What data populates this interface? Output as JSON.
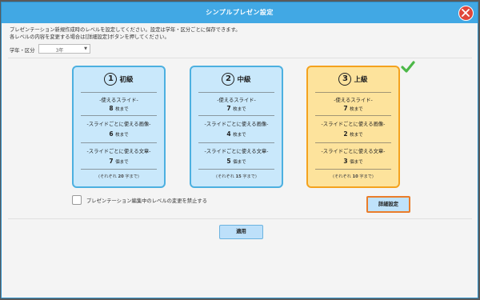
{
  "dialog": {
    "title": "シンプルプレゼン設定",
    "description_line1": "プレゼンテーション新規作成時のレベルを設定してください。設定は学年・区分ごとに保存できます。",
    "description_line2": "各レベルの内容を変更する場合は[詳細設定]ボタンを押してください。",
    "grade_label": "学年・区分",
    "grade_value": "3年"
  },
  "levels": [
    {
      "number": "1",
      "name": "初級",
      "slides_label": "-使えるスライド-",
      "slides_value": "8",
      "slides_unit": "枚まで",
      "images_label": "-スライドごとに使える画像-",
      "images_value": "6",
      "images_unit": "枚まで",
      "texts_label": "-スライドごとに使える文章-",
      "texts_value": "7",
      "texts_unit": "個まで",
      "note_prefix": "(それぞれ",
      "note_value": "20",
      "note_suffix": "字まで)",
      "selected": false
    },
    {
      "number": "2",
      "name": "中級",
      "slides_label": "-使えるスライド-",
      "slides_value": "7",
      "slides_unit": "枚まで",
      "images_label": "-スライドごとに使える画像-",
      "images_value": "4",
      "images_unit": "枚まで",
      "texts_label": "-スライドごとに使える文章-",
      "texts_value": "5",
      "texts_unit": "個まで",
      "note_prefix": "(それぞれ",
      "note_value": "15",
      "note_suffix": "字まで)",
      "selected": false
    },
    {
      "number": "3",
      "name": "上級",
      "slides_label": "-使えるスライド-",
      "slides_value": "7",
      "slides_unit": "枚まで",
      "images_label": "-スライドごとに使える画像-",
      "images_value": "2",
      "images_unit": "枚まで",
      "texts_label": "-スライドごとに使える文章-",
      "texts_value": "3",
      "texts_unit": "個まで",
      "note_prefix": "(それぞれ",
      "note_value": "10",
      "note_suffix": "字まで)",
      "selected": true
    }
  ],
  "lock_checkbox_label": "プレゼンテーション編集中のレベルの変更を禁止する",
  "detail_button_label": "詳細設定",
  "apply_button_label": "適用",
  "colors": {
    "titlebar": "#41a8e4",
    "card_blue": "#c9e8fb",
    "card_selected": "#fde39c",
    "accent_orange": "#ea7d2a",
    "check_green": "#4cb848",
    "close_red": "#e0463a"
  }
}
